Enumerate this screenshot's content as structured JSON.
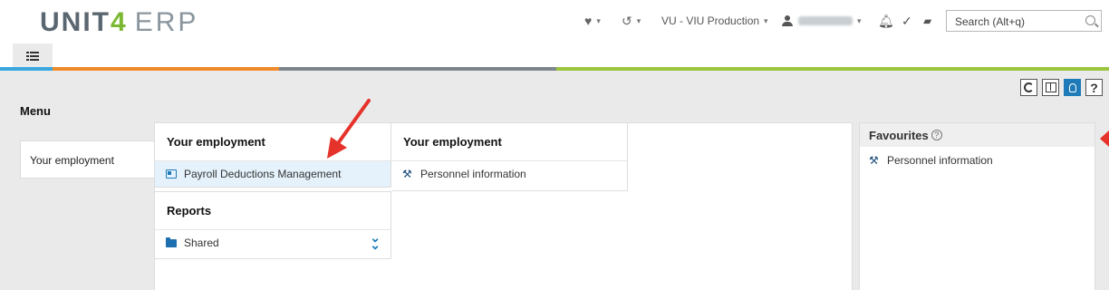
{
  "header": {
    "logo_unit": "UNIT",
    "logo_four": "4",
    "logo_erp": "ERP",
    "company_selector": "VU - VIU Production",
    "search_placeholder": "Search (Alt+q)"
  },
  "main": {
    "menu_title": "Menu",
    "side_item": "Your employment",
    "card1": {
      "title": "Your employment",
      "item": "Payroll Deductions Management"
    },
    "card2": {
      "title": "Your employment",
      "item": "Personnel information"
    },
    "reports": {
      "title": "Reports",
      "item": "Shared"
    },
    "favourites": {
      "title": "Favourites",
      "help": "?",
      "item": "Personnel information"
    }
  },
  "toolbar": {
    "help_label": "?"
  },
  "icons": {
    "favorites": "heart-icon",
    "history": "history-icon",
    "user": "user-icon",
    "notifications": "bell-icon",
    "tasks": "checkmark-icon",
    "messages": "chat-icon",
    "search": "search-icon"
  },
  "colors": {
    "accent": "#1e7ab8",
    "brand_green": "#7cb832",
    "stripe_orange": "#ef8a2b",
    "stripe_gray": "#7d868c",
    "stripe_green": "#9bc53d",
    "stripe_blue": "#3aa8df",
    "arrow": "#e5322a"
  }
}
